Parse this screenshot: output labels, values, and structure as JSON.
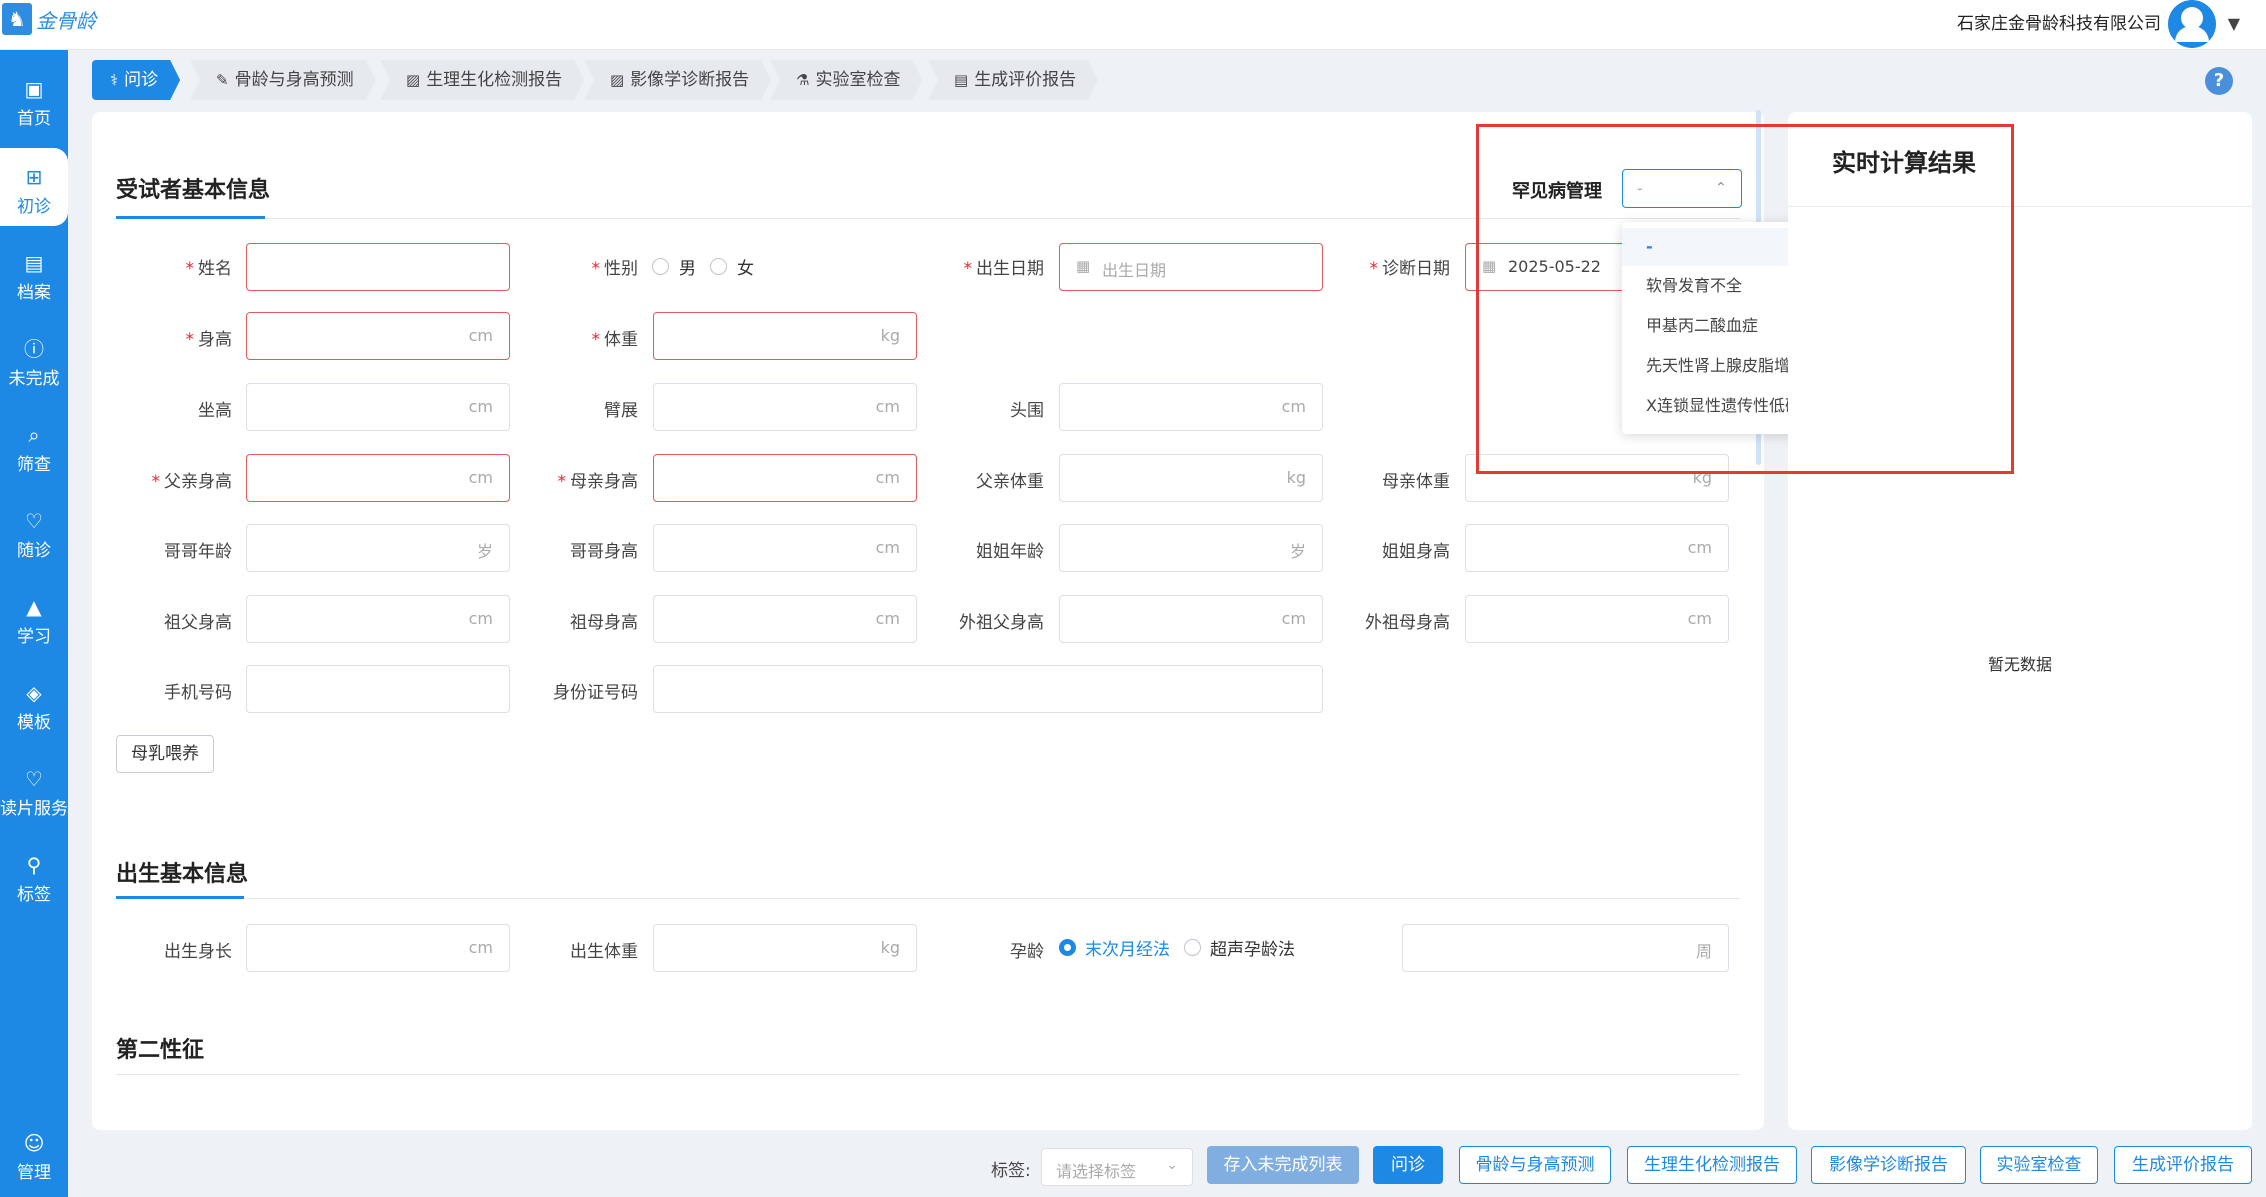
{
  "header": {
    "logo_text": "金骨龄",
    "company": "石家庄金骨龄科技有限公司"
  },
  "sidebar": {
    "items": [
      {
        "label": "首页"
      },
      {
        "label": "初诊"
      },
      {
        "label": "档案"
      },
      {
        "label": "未完成"
      },
      {
        "label": "筛查"
      },
      {
        "label": "随诊"
      },
      {
        "label": "学习"
      },
      {
        "label": "模板"
      },
      {
        "label": "读片服务"
      },
      {
        "label": "标签"
      },
      {
        "label": "管理"
      }
    ]
  },
  "tabs": [
    "问诊",
    "骨龄与身高预测",
    "生理生化检测报告",
    "影像学诊断报告",
    "实验室检查",
    "生成评价报告"
  ],
  "basic": {
    "title": "受试者基本信息",
    "name": "姓名",
    "sex": "性别",
    "male": "男",
    "female": "女",
    "birth_date": "出生日期",
    "birth_date_placeholder": "出生日期",
    "diag_date": "诊断日期",
    "diag_date_value": "2025-05-22",
    "height": "身高",
    "weight": "体重",
    "sitting_height": "坐高",
    "arm_span": "臂展",
    "head_circ": "头围",
    "father_height": "父亲身高",
    "mother_height": "母亲身高",
    "father_weight": "父亲体重",
    "mother_weight": "母亲体重",
    "brother_age": "哥哥年龄",
    "brother_height": "哥哥身高",
    "sister_age": "姐姐年龄",
    "sister_height": "姐姐身高",
    "grandpa_height": "祖父身高",
    "grandma_height": "祖母身高",
    "m_grandpa_height": "外祖父身高",
    "m_grandma_height": "外祖母身高",
    "phone": "手机号码",
    "id_card": "身份证号码",
    "breastfeeding": "母乳喂养",
    "unit_cm": "cm",
    "unit_kg": "kg",
    "unit_age": "岁"
  },
  "birth": {
    "title": "出生基本信息",
    "length": "出生身长",
    "weight": "出生体重",
    "gestation": "孕龄",
    "method_lmp": "末次月经法",
    "method_us": "超声孕龄法",
    "unit_week": "周",
    "unit_cm": "cm",
    "unit_kg": "kg"
  },
  "secondary": {
    "title": "第二性征"
  },
  "rare": {
    "label": "罕见病管理",
    "value": "-",
    "options": [
      "-",
      "软骨发育不全",
      "甲基丙二酸血症",
      "先天性肾上腺皮脂增生症",
      "X连锁显性遗传性低磷血症性佝偻病"
    ],
    "selected_index": 0
  },
  "realtime": {
    "title": "实时计算结果",
    "empty": "暂无数据"
  },
  "bottom": {
    "tag_label": "标签:",
    "tag_placeholder": "请选择标签",
    "save_unfinished": "存入未完成列表",
    "buttons": [
      "问诊",
      "骨龄与身高预测",
      "生理生化检测报告",
      "影像学诊断报告",
      "实验室检查",
      "生成评价报告"
    ]
  },
  "colors": {
    "accent": "#1e88e5",
    "error_border": "#e25a5a",
    "highlight_box": "#e53935"
  }
}
